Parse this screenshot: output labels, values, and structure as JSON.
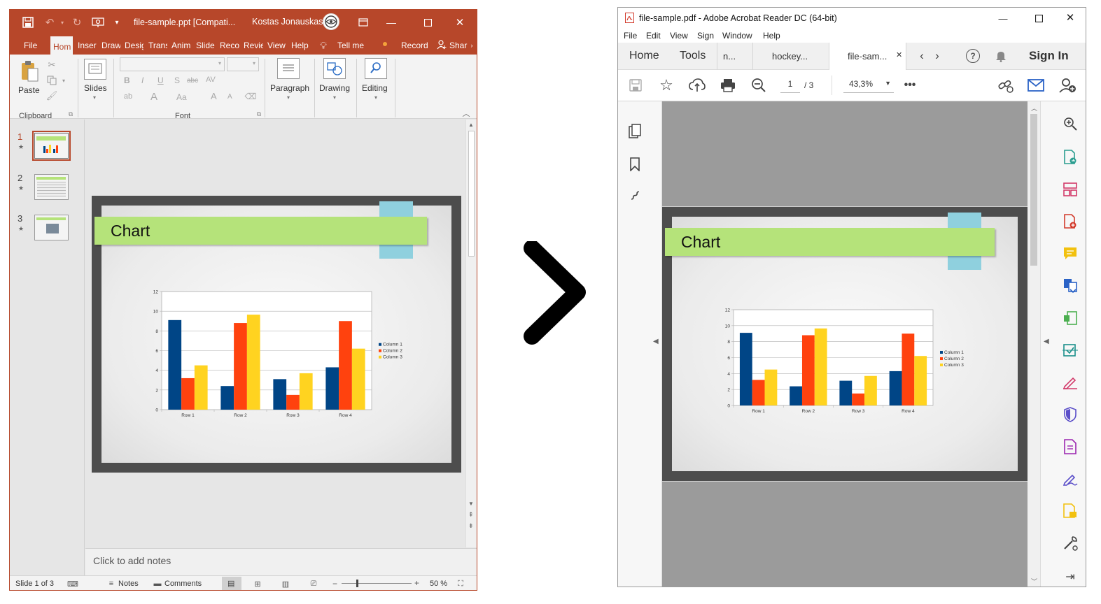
{
  "powerpoint": {
    "title_bar": {
      "filename": "file-sample.ppt [Compati...",
      "user": "Kostas Jonauskas"
    },
    "tabs": [
      "File",
      "Hom",
      "Inser",
      "Draw",
      "Desig",
      "Trans",
      "Anim",
      "Slide",
      "Reco",
      "Revie",
      "View",
      "Help"
    ],
    "tell_me": "Tell me",
    "record": "Record",
    "share": "Shar",
    "ribbon": {
      "paste": "Paste",
      "clipboard": "Clipboard",
      "slides": "Slides",
      "font": "Font",
      "paragraph": "Paragraph",
      "drawing": "Drawing",
      "editing": "Editing",
      "bold": "B",
      "italic": "I",
      "underline": "U",
      "strike": "S",
      "abc": "abc",
      "av": "AV",
      "font_a": "A",
      "aa": "Aa"
    },
    "slide_numbers": [
      "1",
      "2",
      "3"
    ],
    "notes_placeholder": "Click to add notes",
    "status": {
      "slide_info": "Slide 1 of 3",
      "notes": "Notes",
      "comments": "Comments",
      "zoom": "50 %"
    }
  },
  "slide": {
    "title": "Chart"
  },
  "chart_data": {
    "type": "bar",
    "categories": [
      "Row 1",
      "Row 2",
      "Row 3",
      "Row 4"
    ],
    "series": [
      {
        "name": "Column 1",
        "values": [
          9.1,
          2.4,
          3.1,
          4.3
        ],
        "color": "#004586"
      },
      {
        "name": "Column 2",
        "values": [
          3.2,
          8.8,
          1.5,
          9.0
        ],
        "color": "#ff420e"
      },
      {
        "name": "Column 3",
        "values": [
          4.5,
          9.65,
          3.7,
          6.2
        ],
        "color": "#ffd320"
      }
    ],
    "yticks": [
      "0",
      "2",
      "4",
      "6",
      "8",
      "10",
      "12"
    ],
    "ylim": [
      0,
      12
    ],
    "grid": true,
    "legend": "right"
  },
  "acrobat": {
    "title": "file-sample.pdf - Adobe Acrobat Reader DC (64-bit)",
    "menu": [
      "File",
      "Edit",
      "View",
      "Sign",
      "Window",
      "Help"
    ],
    "tabs": {
      "home": "Home",
      "tools": "Tools",
      "tab_a": "n...",
      "tab_b": "hockey...",
      "tab_c": "file-sam...",
      "sign_in": "Sign In"
    },
    "toolbar": {
      "page_current": "1",
      "page_total": "/ 3",
      "zoom": "43,3%"
    }
  }
}
